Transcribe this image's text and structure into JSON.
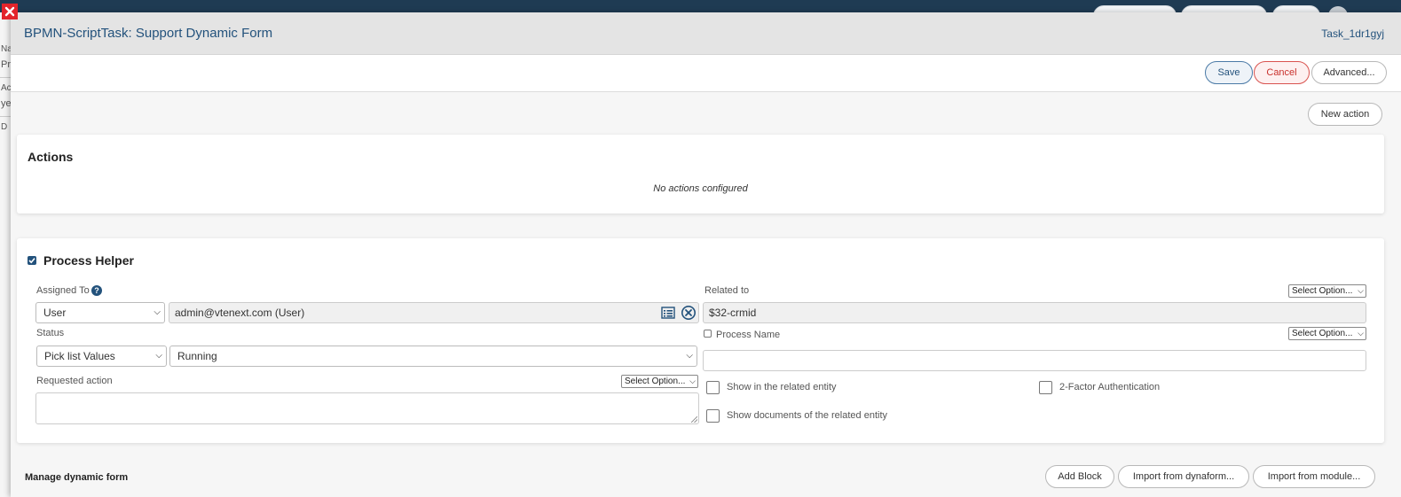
{
  "background": {
    "fragments": [
      "Na",
      "Pr",
      "Ac",
      "ye",
      "D"
    ]
  },
  "modal": {
    "title": "BPMN-ScriptTask: Support Dynamic Form",
    "task_id": "Task_1dr1gyj"
  },
  "toolbar": {
    "save_label": "Save",
    "cancel_label": "Cancel",
    "advanced_label": "Advanced..."
  },
  "actions_section": {
    "new_action_label": "New action",
    "title": "Actions",
    "empty_message": "No actions configured"
  },
  "process_helper": {
    "checked": true,
    "title": "Process Helper",
    "assigned_to": {
      "label": "Assigned To",
      "type_value": "User",
      "user_value": "admin@vtenext.com (User)"
    },
    "status": {
      "label": "Status",
      "source_value": "Pick list Values",
      "value": "Running"
    },
    "requested_action": {
      "label": "Requested action",
      "option_select": "Select Option...",
      "value": ""
    },
    "related_to": {
      "label": "Related to",
      "option_select": "Select Option...",
      "value": "$32-crmid"
    },
    "process_name": {
      "label": "Process Name",
      "checked": false,
      "option_select": "Select Option...",
      "value": ""
    },
    "show_in_related_entity": {
      "label": "Show in the related entity",
      "checked": false
    },
    "two_factor_auth": {
      "label": "2-Factor Authentication",
      "checked": false
    },
    "show_documents": {
      "label": "Show documents of the related entity",
      "checked": false
    }
  },
  "dynamic_form": {
    "title": "Manage dynamic form",
    "add_block_label": "Add Block",
    "import_dynaform_label": "Import from dynaform...",
    "import_module_label": "Import from module..."
  },
  "colors": {
    "accent": "#23527c",
    "danger": "#d9534f",
    "header_bg": "#e4e4e4",
    "close_red": "#e3242b"
  }
}
